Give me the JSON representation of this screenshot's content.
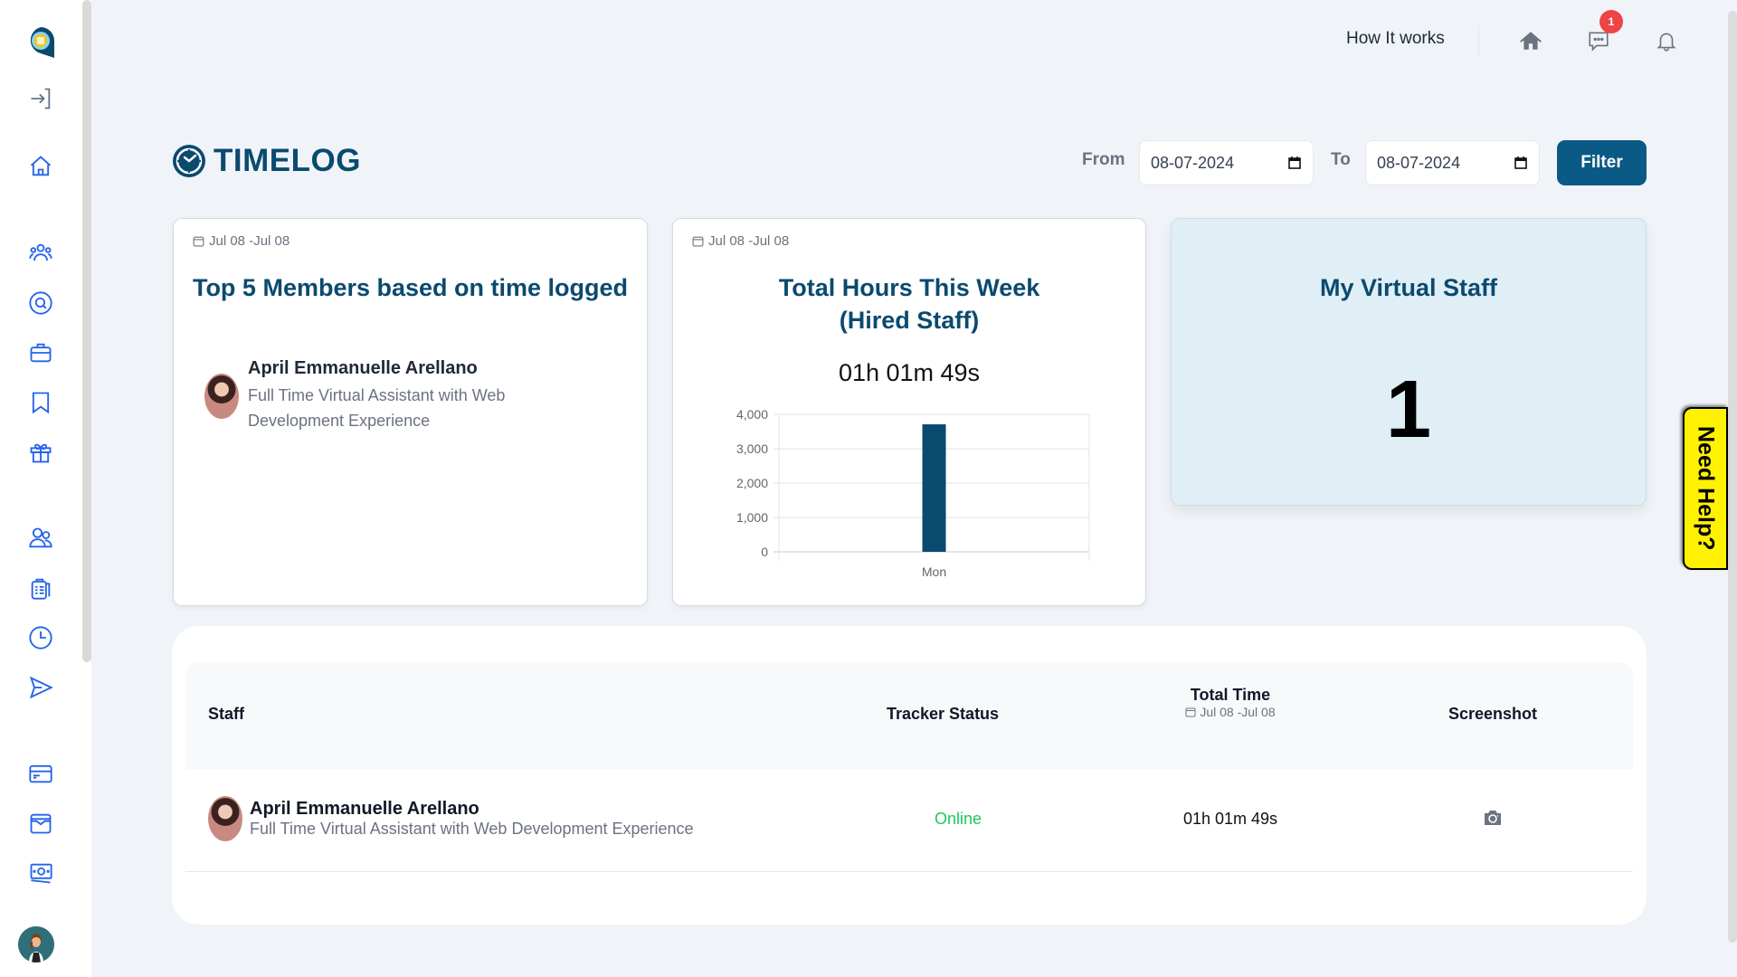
{
  "sidebar": {
    "items": [
      {
        "icon": "logo-icon",
        "label": "App logo"
      },
      {
        "icon": "sign-in-icon",
        "label": "Login"
      },
      {
        "icon": "home-icon",
        "label": "Home"
      },
      {
        "icon": "team-icon",
        "label": "Team"
      },
      {
        "icon": "search-icon",
        "label": "Search"
      },
      {
        "icon": "briefcase-icon",
        "label": "Jobs"
      },
      {
        "icon": "bookmark-icon",
        "label": "Bookmarks"
      },
      {
        "icon": "gift-icon",
        "label": "Rewards"
      },
      {
        "icon": "users-icon",
        "label": "Users"
      },
      {
        "icon": "clipboard-icon",
        "label": "Tasks"
      },
      {
        "icon": "clock-icon",
        "label": "Timelog"
      },
      {
        "icon": "send-icon",
        "label": "Messages"
      },
      {
        "icon": "credit-card-icon",
        "label": "Billing"
      },
      {
        "icon": "wallet-icon",
        "label": "Wallet"
      },
      {
        "icon": "money-icon",
        "label": "Payments"
      }
    ]
  },
  "topbar": {
    "how_it_works": "How It works",
    "message_badge": "1",
    "icons": [
      "home-icon",
      "chat-icon",
      "bell-icon"
    ]
  },
  "page": {
    "title": "TIMELOG",
    "filter": {
      "from_label": "From",
      "from_value": "08-07-2024",
      "to_label": "To",
      "to_value": "08-07-2024",
      "button": "Filter"
    }
  },
  "cards": {
    "top_members": {
      "date_range": "Jul 08 -Jul 08",
      "title": "Top 5 Members based on time logged",
      "members": [
        {
          "name": "April Emmanuelle Arellano",
          "role": "Full Time Virtual Assistant with Web Development Experience"
        }
      ]
    },
    "total_hours": {
      "date_range": "Jul 08 -Jul 08",
      "title_line1": "Total Hours This Week",
      "title_line2": "(Hired Staff)",
      "total": "01h 01m 49s"
    },
    "virtual_staff": {
      "title": "My Virtual Staff",
      "count": "1"
    }
  },
  "chart_data": {
    "type": "bar",
    "categories": [
      "Mon"
    ],
    "values": [
      3709
    ],
    "title": "",
    "xlabel": "",
    "ylabel": "",
    "ylim": [
      0,
      4000
    ],
    "yticks": [
      0,
      1000,
      2000,
      3000,
      4000
    ],
    "ytick_labels": [
      "0",
      "1,000",
      "2,000",
      "3,000",
      "4,000"
    ],
    "grid": true,
    "color": "#0b4a6f"
  },
  "need_help": "Need Help?",
  "table": {
    "headers": {
      "staff": "Staff",
      "tracker_status": "Tracker Status",
      "total_time": "Total Time",
      "total_time_range": "Jul 08 -Jul 08",
      "screenshot": "Screenshot"
    },
    "rows": [
      {
        "name": "April Emmanuelle Arellano",
        "role": "Full Time Virtual Assistant with Web Development Experience",
        "status": "Online",
        "total_time": "01h 01m 49s",
        "screenshot_icon": "camera-icon"
      }
    ]
  },
  "colors": {
    "brand": "#0b4a6f",
    "button": "#0b5a85",
    "online": "#22c55e",
    "badge": "#ef4444",
    "need_help_bg": "#fff200",
    "sidebar_icon": "#2563eb"
  }
}
